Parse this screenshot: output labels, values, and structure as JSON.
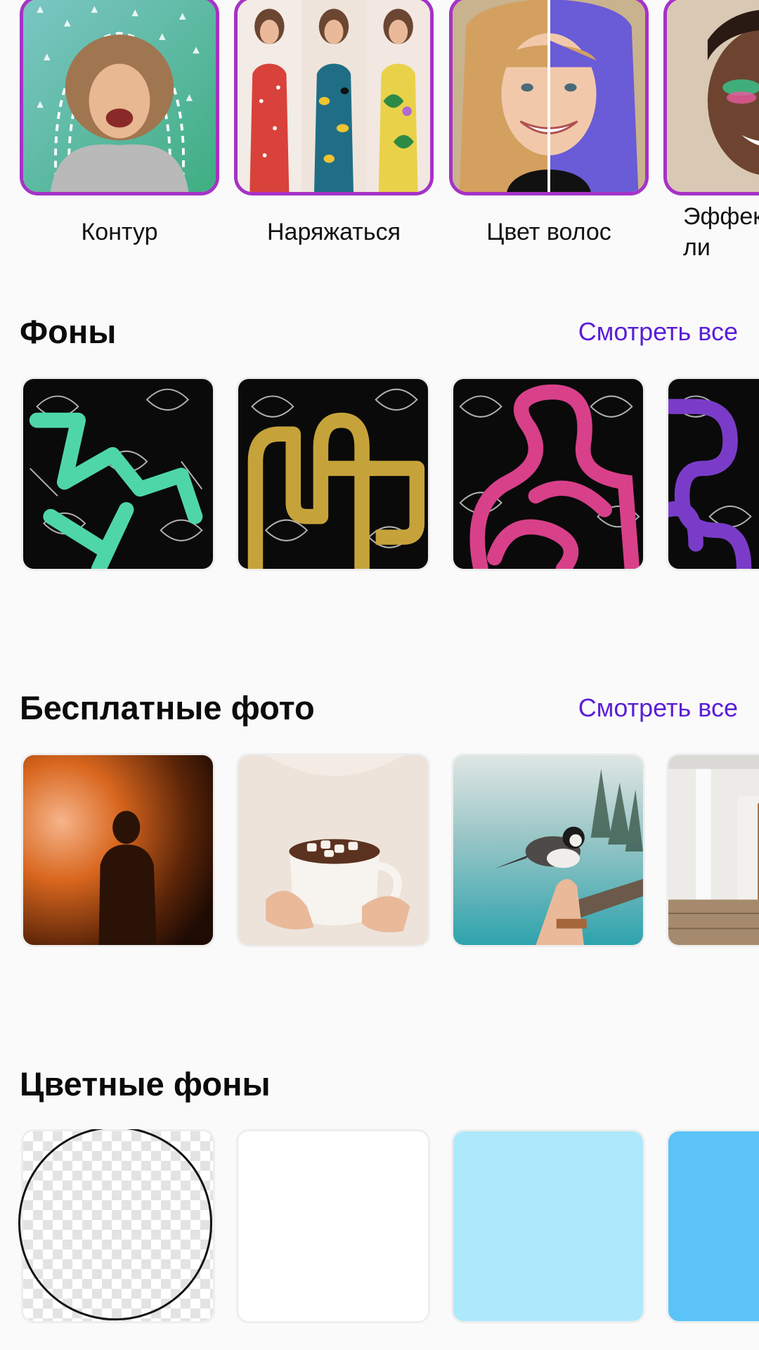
{
  "effects": {
    "items": [
      {
        "label": "Контур",
        "icon": "outline-effect-thumbnail"
      },
      {
        "label": "Наряжаться",
        "icon": "dress-up-effect-thumbnail"
      },
      {
        "label": "Цвет волос",
        "icon": "hair-color-effect-thumbnail"
      },
      {
        "label": "Эффек\nли",
        "icon": "face-effect-thumbnail"
      }
    ],
    "border_color": "#a632c6"
  },
  "backgrounds": {
    "title": "Фоны",
    "see_all": "Смотреть все",
    "accent_colors": [
      "#4fd6a8",
      "#c6a33a",
      "#d8408a",
      "#7a3cc8"
    ]
  },
  "free_photos": {
    "title": "Бесплатные фото",
    "see_all": "Смотреть все",
    "items": [
      "silhouette-in-orange-light",
      "hands-holding-cocoa-mug",
      "bird-on-hand-by-lake",
      "white-house-porch"
    ]
  },
  "color_backgrounds": {
    "title": "Цветные фоны",
    "swatches": [
      {
        "name": "transparent",
        "color": ""
      },
      {
        "name": "white",
        "color": "#ffffff"
      },
      {
        "name": "light-blue",
        "color": "#aee9fb"
      },
      {
        "name": "blue",
        "color": "#5bc3f7"
      }
    ]
  },
  "colors": {
    "link": "#5a1fd6",
    "background": "#fafafa"
  }
}
